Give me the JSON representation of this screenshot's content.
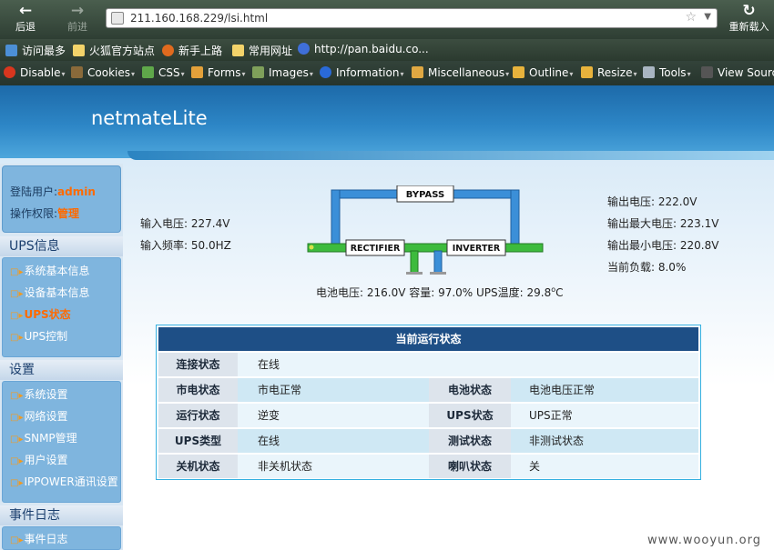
{
  "browser": {
    "back_label": "后退",
    "forward_label": "前进",
    "reload_label": "重新载入",
    "url": "211.160.168.229/lsi.html"
  },
  "bookmarks": [
    {
      "label": "访问最多",
      "icon": "site-icon"
    },
    {
      "label": "火狐官方站点",
      "icon": "folder-icon"
    },
    {
      "label": "新手上路",
      "icon": "firefox-icon"
    },
    {
      "label": "常用网址",
      "icon": "folder-icon"
    },
    {
      "label": "http://pan.baidu.co...",
      "icon": "baidu-icon"
    }
  ],
  "devtools": [
    {
      "label": "Disable",
      "icon": "disable-icon"
    },
    {
      "label": "Cookies",
      "icon": "cookie-icon"
    },
    {
      "label": "CSS",
      "icon": "css-icon"
    },
    {
      "label": "Forms",
      "icon": "forms-icon"
    },
    {
      "label": "Images",
      "icon": "image-icon"
    },
    {
      "label": "Information",
      "icon": "info-icon"
    },
    {
      "label": "Miscellaneous",
      "icon": "misc-icon"
    },
    {
      "label": "Outline",
      "icon": "outline-icon"
    },
    {
      "label": "Resize",
      "icon": "resize-icon"
    },
    {
      "label": "Tools",
      "icon": "tools-icon"
    },
    {
      "label": "View Sourc",
      "icon": "source-icon"
    }
  ],
  "app": {
    "logo": "netmateLite"
  },
  "user": {
    "login_label": "登陆用户:",
    "login_value": "admin",
    "perm_label": "操作权限:",
    "perm_value": "管理"
  },
  "sidebar": {
    "sections": [
      {
        "title": "UPS信息",
        "items": [
          "系统基本信息",
          "设备基本信息",
          "UPS状态",
          "UPS控制"
        ],
        "active": 2
      },
      {
        "title": "设置",
        "items": [
          "系统设置",
          "网络设置",
          "SNMP管理",
          "用户设置",
          "IPPOWER通讯设置"
        ]
      },
      {
        "title": "事件日志",
        "items": [
          "事件日志"
        ]
      }
    ]
  },
  "input": {
    "voltage": "输入电压:  227.4V",
    "frequency": "输入频率:  50.0HZ"
  },
  "output": {
    "voltage": "输出电压:  222.0V",
    "max_voltage": "输出最大电压:  223.1V",
    "min_voltage": "输出最小电压:  220.8V",
    "load": "当前负载:   8.0%"
  },
  "diagram": {
    "bypass": "BYPASS",
    "rectifier": "RECTIFIER",
    "inverter": "INVERTER",
    "colors": {
      "bypass_line": "#3b8fd8",
      "main_line": "#3dbb3d",
      "battery_line": "#3b8fd8"
    }
  },
  "battery_line": {
    "text": "电池电压: 216.0V 容量: 97.0% UPS温度: 29.8",
    "degree_sup": "o",
    "unit": "C"
  },
  "status_table": {
    "title": "当前运行状态",
    "rows": [
      [
        {
          "label": "连接状态",
          "value": "在线"
        }
      ],
      [
        {
          "label": "市电状态",
          "value": "市电正常"
        },
        {
          "label": "电池状态",
          "value": "电池电压正常"
        }
      ],
      [
        {
          "label": "运行状态",
          "value": "逆变"
        },
        {
          "label": "UPS状态",
          "value": "UPS正常"
        }
      ],
      [
        {
          "label": "UPS类型",
          "value": "在线"
        },
        {
          "label": "测试状态",
          "value": "非测试状态"
        }
      ],
      [
        {
          "label": "关机状态",
          "value": "非关机状态"
        },
        {
          "label": "喇叭状态",
          "value": "关"
        }
      ]
    ]
  },
  "watermark": "www.wooyun.org"
}
